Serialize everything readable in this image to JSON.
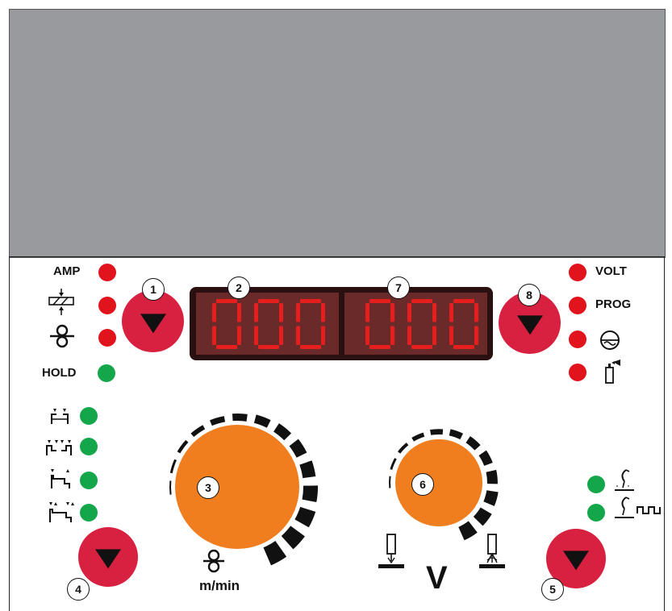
{
  "colors": {
    "top_area": "#999a9d",
    "led_red": "#e1141e",
    "led_green": "#14a64a",
    "button": "#d82040",
    "knob": "#f07d1e",
    "display_bg": "#2a1010",
    "display_digits": "#e61e1e"
  },
  "left_indicators": {
    "amp": "AMP",
    "hold": "HOLD"
  },
  "right_indicators": {
    "volt": "VOLT",
    "prog": "PROG"
  },
  "display": {
    "left_value": "000",
    "right_value": "000"
  },
  "callouts": {
    "n1": "1",
    "n2": "2",
    "n3": "3",
    "n4": "4",
    "n5": "5",
    "n6": "6",
    "n7": "7",
    "n8": "8"
  },
  "units": {
    "wire_speed": "m/min",
    "voltage": "V"
  },
  "icons": {
    "thickness": "thickness-icon",
    "wire_feed": "wire-roller-icon",
    "two_stroke": "2-stroke-icon",
    "four_stroke": "4-stroke-icon",
    "crater_two": "crater-2-stroke-icon",
    "crater_four": "crater-4-stroke-icon",
    "arc": "arc-icon",
    "gas_bottle": "gas-bottle-icon",
    "mig": "mig-torch-icon",
    "pulse": "pulsed-mig-torch-icon"
  }
}
